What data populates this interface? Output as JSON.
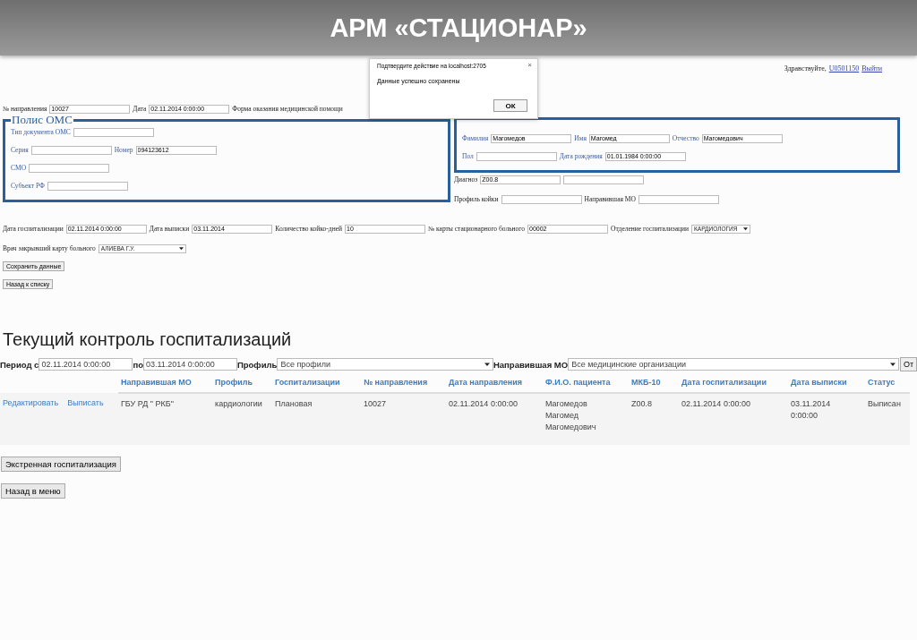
{
  "slide_title": "АРМ «СТАЦИОНАР»",
  "header": {
    "greeting": "Здравствуйте,",
    "user": "U0501150",
    "logout": "Выйти"
  },
  "dialog": {
    "title": "Подтвердите действие на localhost:2705",
    "close": "×",
    "message": "Данные успешно сохранены",
    "button": "ОК"
  },
  "referral_row": [
    {
      "label": "№ направления",
      "kind": "input",
      "value": "10027"
    },
    {
      "label": "Дата",
      "kind": "input",
      "value": "02.11.2014 0:00:00"
    },
    {
      "label": "Форма оказания медицинской помощи",
      "kind": "hidden"
    }
  ],
  "policy": {
    "legend": "Полис ОМС",
    "rows": [
      [
        {
          "label": "Тип документа ОМС",
          "kind": "input"
        }
      ],
      [
        {
          "label": "Серия",
          "kind": "input"
        },
        {
          "label": "Номер",
          "kind": "input",
          "value": "094123612"
        }
      ],
      [
        {
          "label": "СМО",
          "kind": "input"
        }
      ],
      [
        {
          "label": "Субъект РФ",
          "kind": "input"
        }
      ]
    ]
  },
  "patient": {
    "rows": [
      [
        {
          "label": "Фамилия",
          "kind": "input",
          "value": "Магомедов"
        },
        {
          "label": "Имя",
          "kind": "input",
          "value": "Магомед"
        },
        {
          "label": "Отчество",
          "kind": "input",
          "value": "Магомедович"
        }
      ],
      [
        {
          "label": "Пол",
          "kind": "input"
        },
        {
          "label": "Дата рождения",
          "kind": "input",
          "value": "01.01.1984 0:00:00"
        }
      ]
    ]
  },
  "diagnosis": {
    "label": "Диагноз",
    "fields": [
      {
        "kind": "input",
        "value": "Z00.8"
      },
      {
        "kind": "input"
      }
    ]
  },
  "bed_row": [
    {
      "label": "Профиль койки",
      "kind": "input"
    },
    {
      "label": "Направившая МО",
      "kind": "input"
    }
  ],
  "hosp_row": [
    {
      "label": "Дата госпитализации",
      "kind": "input",
      "value": "02.11.2014 0:00:00"
    },
    {
      "label": "Дата выписки",
      "kind": "input",
      "value": "03.11.2014"
    },
    {
      "label": "Количество койко-дней",
      "kind": "input",
      "value": "10"
    },
    {
      "label": "№ карты стационарного больного",
      "kind": "input",
      "value": "00002"
    },
    {
      "label": "Отделение госпитализации",
      "kind": "select",
      "value": "КАРДИОЛОГИЯ"
    }
  ],
  "doctor": {
    "label": "Врач закрывший карту больного",
    "kind": "select",
    "value": "АЛИЕВА Г.У."
  },
  "form_buttons": [
    "Сохранить данные",
    "Назад к списку"
  ],
  "section_title": "Текущий контроль госпитализаций",
  "filters": [
    {
      "label": "Период с",
      "kind": "input",
      "value": "02.11.2014 0:00:00"
    },
    {
      "label": "по",
      "kind": "input",
      "value": "03.11.2014 0:00:00"
    },
    {
      "label": "Профиль",
      "kind": "select",
      "value": "Все профили"
    },
    {
      "label": "Направившая МО",
      "kind": "select",
      "value": "Все медицинские организации"
    }
  ],
  "filter_button": "От",
  "table": {
    "columns": [
      "Направившая МО",
      "Профиль",
      "Госпитализации",
      "№ направления",
      "Дата направления",
      "Ф.И.О. пациента",
      "МКБ-10",
      "Дата госпитализации",
      "Дата выписки",
      "Статус"
    ],
    "rows": [
      {
        "actions": [
          "Редактировать",
          "Выписать"
        ],
        "cells": [
          "ГБУ РД \" РКБ\"",
          "кардиологии",
          "Плановая",
          "10027",
          "02.11.2014 0:00:00",
          "Магомедов Магомед Магомедович",
          "Z00.8",
          "02.11.2014 0:00:00",
          "03.11.2014 0:00:00",
          "Выписан"
        ]
      }
    ]
  },
  "bottom_buttons": [
    "Экстренная госпитализация",
    "Назад в меню"
  ]
}
